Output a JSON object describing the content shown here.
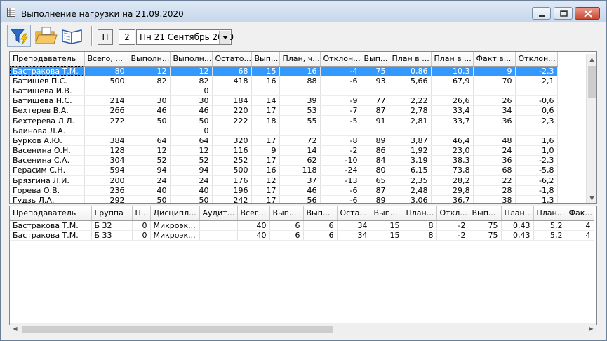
{
  "window": {
    "title": "Выполнение нагрузки на 21.09.2020",
    "icon": "table-app-icon"
  },
  "toolbar": {
    "filter_icon": "filter-lightning-icon",
    "folder_icon": "folder-open-icon",
    "book_icon": "open-book-icon",
    "p_label": "П",
    "week_number": "2",
    "date_value": "Пн 21 Сентябрь 2020"
  },
  "top_grid": {
    "columns": [
      "Преподаватель",
      "Всего, ...",
      "Выполн...",
      "Выполн...",
      "Остато...",
      "Вып...",
      "План, ч...",
      "Отклон...",
      "Вып...",
      "План в ...",
      "План в ...",
      "Факт в...",
      "Отклон..."
    ],
    "rows": [
      [
        "Бастракова Т.М.",
        "80",
        "12",
        "12",
        "68",
        "15",
        "16",
        "-4",
        "75",
        "0,86",
        "10,3",
        "9",
        "-2,3"
      ],
      [
        "Батищев П.С.",
        "500",
        "82",
        "82",
        "418",
        "16",
        "88",
        "-6",
        "93",
        "5,66",
        "67,9",
        "70",
        "2,1"
      ],
      [
        "Батищева И.В.",
        "",
        "",
        "0",
        "",
        "",
        "",
        "",
        "",
        "",
        "",
        "",
        ""
      ],
      [
        "Батищева Н.С.",
        "214",
        "30",
        "30",
        "184",
        "14",
        "39",
        "-9",
        "77",
        "2,22",
        "26,6",
        "26",
        "-0,6"
      ],
      [
        "Бехтерев В.А.",
        "266",
        "46",
        "46",
        "220",
        "17",
        "53",
        "-7",
        "87",
        "2,78",
        "33,4",
        "34",
        "0,6"
      ],
      [
        "Бехтерева Л.Л.",
        "272",
        "50",
        "50",
        "222",
        "18",
        "55",
        "-5",
        "91",
        "2,81",
        "33,7",
        "36",
        "2,3"
      ],
      [
        "Блинова Л.А.",
        "",
        "",
        "0",
        "",
        "",
        "",
        "",
        "",
        "",
        "",
        "",
        ""
      ],
      [
        "Бурков А.Ю.",
        "384",
        "64",
        "64",
        "320",
        "17",
        "72",
        "-8",
        "89",
        "3,87",
        "46,4",
        "48",
        "1,6"
      ],
      [
        "Васенина О.Н.",
        "128",
        "12",
        "12",
        "116",
        "9",
        "14",
        "-2",
        "86",
        "1,92",
        "23,0",
        "24",
        "1,0"
      ],
      [
        "Васенина С.А.",
        "304",
        "52",
        "52",
        "252",
        "17",
        "62",
        "-10",
        "84",
        "3,19",
        "38,3",
        "36",
        "-2,3"
      ],
      [
        "Герасим С.Н.",
        "594",
        "94",
        "94",
        "500",
        "16",
        "118",
        "-24",
        "80",
        "6,15",
        "73,8",
        "68",
        "-5,8"
      ],
      [
        "Брязгина Л.И.",
        "200",
        "24",
        "24",
        "176",
        "12",
        "37",
        "-13",
        "65",
        "2,35",
        "28,2",
        "22",
        "-6,2"
      ],
      [
        "Горева О.В.",
        "236",
        "40",
        "40",
        "196",
        "17",
        "46",
        "-6",
        "87",
        "2,48",
        "29,8",
        "28",
        "-1,8"
      ],
      [
        "Гудзь Л.А.",
        "292",
        "50",
        "50",
        "242",
        "17",
        "56",
        "-6",
        "89",
        "3,06",
        "36,7",
        "38",
        "1,3"
      ]
    ],
    "selected_row": 0
  },
  "bottom_grid": {
    "columns": [
      "Преподаватель",
      "Группа",
      "П...",
      "Дисципл...",
      "Аудит...",
      "Всег...",
      "Вып...",
      "Вып...",
      "Оста...",
      "Вып...",
      "План...",
      "Откл...",
      "Вып...",
      "План...",
      "План...",
      "Фак..."
    ],
    "rows": [
      [
        "Бастракова Т.М.",
        "Б 32",
        "0",
        "Микроэк...",
        "",
        "40",
        "6",
        "6",
        "34",
        "15",
        "8",
        "-2",
        "75",
        "0,43",
        "5,2",
        "4"
      ],
      [
        "Бастракова Т.М.",
        "Б 33",
        "0",
        "Микроэк...",
        "",
        "40",
        "6",
        "6",
        "34",
        "15",
        "8",
        "-2",
        "75",
        "0,43",
        "5,2",
        "4"
      ]
    ]
  }
}
